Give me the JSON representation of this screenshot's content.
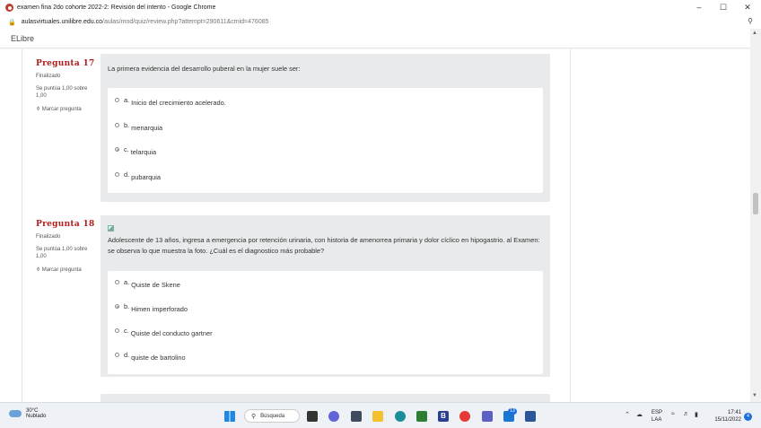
{
  "window": {
    "title": "examen fina 2do cohorte 2022-2: Revisión del intento - Google Chrome",
    "url_host": "aulasvirtuales.unilibre.edu.co",
    "url_path": "/aulas/mod/quiz/review.php?attempt=290611&cmid=476085",
    "controls": {
      "minimize": "–",
      "maximize": "☐",
      "close": "✕"
    }
  },
  "site": {
    "brand": "ELibre"
  },
  "questions": [
    {
      "number_label": "Pregunta",
      "number": "17",
      "state": "Finalizado",
      "grade": "Se puntúa 1,00 sobre 1,00",
      "flag_label": "Marcar pregunta",
      "text": "La primera evidencia del desarrollo puberal en la mujer suele ser:",
      "options": [
        {
          "letter": "a.",
          "text": "Inicio del crecimiento acelerado.",
          "selected": false
        },
        {
          "letter": "b.",
          "text": "menarquia",
          "selected": false
        },
        {
          "letter": "c.",
          "text": "telarquia",
          "selected": true
        },
        {
          "letter": "d.",
          "text": "pubarquia",
          "selected": false
        }
      ]
    },
    {
      "number_label": "Pregunta",
      "number": "18",
      "state": "Finalizado",
      "grade": "Se puntúa 1,00 sobre 1,00",
      "flag_label": "Marcar pregunta",
      "text": "Adolescente de 13 años, ingresa a emergencia por retención urinaria, con historia de amenorrea  primaria  y  dolor  cíclico  en hipogastrio. al Examen:  se observa lo que muestra la foto.  ¿Cuál  es  el diagnostico más probable?",
      "options": [
        {
          "letter": "a.",
          "text": "Quiste de Skene",
          "selected": false
        },
        {
          "letter": "b.",
          "text": "Himen imperforado",
          "selected": true
        },
        {
          "letter": "c.",
          "text": "Quiste del conducto gartner",
          "selected": false
        },
        {
          "letter": "d.",
          "text": "quiste de bartolino",
          "selected": false
        }
      ]
    }
  ],
  "taskbar": {
    "weather_temp": "30°C",
    "weather_desc": "Nublado",
    "search_label": "Búsqueda",
    "mail_badge": "13",
    "lang_top": "ESP",
    "lang_bottom": "LAA",
    "time": "17:41",
    "date": "15/11/2022",
    "notifications": "4"
  },
  "colors": {
    "question_number": "#b01c1c",
    "question_box": "#e9eaeb",
    "accent_blue": "#1e6fd9"
  }
}
